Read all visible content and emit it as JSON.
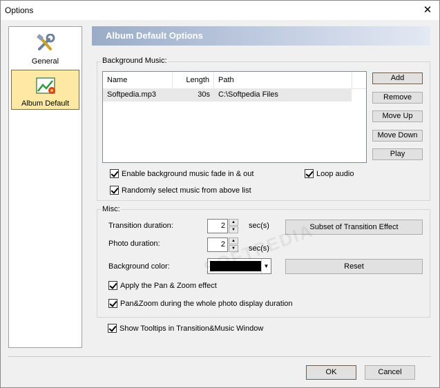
{
  "window": {
    "title": "Options",
    "close_glyph": "✕"
  },
  "sidebar": {
    "items": [
      {
        "label": "General",
        "icon": "tools-icon",
        "selected": false
      },
      {
        "label": "Album Default",
        "icon": "album-chart-icon",
        "selected": true
      }
    ]
  },
  "banner": {
    "title": "Album Default Options"
  },
  "background_music": {
    "group_label": "Background Music:",
    "columns": [
      "Name",
      "Length",
      "Path"
    ],
    "rows": [
      {
        "name": "Softpedia.mp3",
        "length": "30s",
        "path": "C:\\Softpedia Files"
      }
    ],
    "buttons": {
      "add": "Add",
      "remove": "Remove",
      "move_up": "Move Up",
      "move_down": "Move Down",
      "play": "Play"
    },
    "fade": {
      "label": "Enable background music fade in & out",
      "checked": true
    },
    "loop": {
      "label": "Loop audio",
      "checked": true
    },
    "random": {
      "label": "Randomly select music from above list",
      "checked": true
    }
  },
  "misc": {
    "group_label": "Misc:",
    "transition": {
      "label": "Transition duration:",
      "value": "2",
      "unit": "sec(s)"
    },
    "photo": {
      "label": "Photo duration:",
      "value": "2",
      "unit": "sec(s)"
    },
    "bgcolor": {
      "label": "Background color:",
      "color": "#000000"
    },
    "subset_button": "Subset of Transition Effect",
    "reset_button": "Reset",
    "panzoom": {
      "label": "Apply the Pan & Zoom effect",
      "checked": true
    },
    "panzoom_whole": {
      "label": "Pan&Zoom during the whole photo display duration",
      "checked": true
    }
  },
  "tooltips": {
    "label": "Show Tooltips in Transition&Music Window",
    "checked": true
  },
  "footer": {
    "ok": "OK",
    "cancel": "Cancel"
  },
  "watermark": "SOFTPEDIA"
}
